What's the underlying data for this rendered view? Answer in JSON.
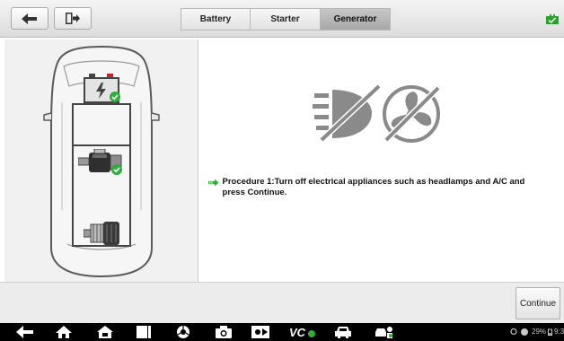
{
  "window": {
    "back_icon": "back-arrow-icon",
    "exit_icon": "exit-icon",
    "battery_icon": "battery-status-icon",
    "accent_color": "#2e9e2e"
  },
  "tabs": [
    {
      "label": "Battery",
      "active": false
    },
    {
      "label": "Starter",
      "active": false
    },
    {
      "label": "Generator",
      "active": true
    }
  ],
  "diagram": {
    "battery_icon": "battery-icon",
    "starter_icon": "starter-motor-icon",
    "generator_icon": "generator-icon",
    "check_icon": "check-badge-icon"
  },
  "status_icons": [
    "headlamp-off-icon",
    "fan-off-icon"
  ],
  "procedure": {
    "text": "Procedure 1:Turn off electrical appliances such as headlamps and A/C and press Continue."
  },
  "actions": {
    "continue_label": "Continue"
  },
  "system_bar": {
    "icons": [
      "back-icon",
      "home-icon",
      "autel-home-icon",
      "recent-apps-icon",
      "browser-icon",
      "camera-icon",
      "display-icon",
      "vci-icon",
      "car-icon",
      "service-icon"
    ],
    "battery_percent": "29%",
    "clock": "9:3"
  }
}
